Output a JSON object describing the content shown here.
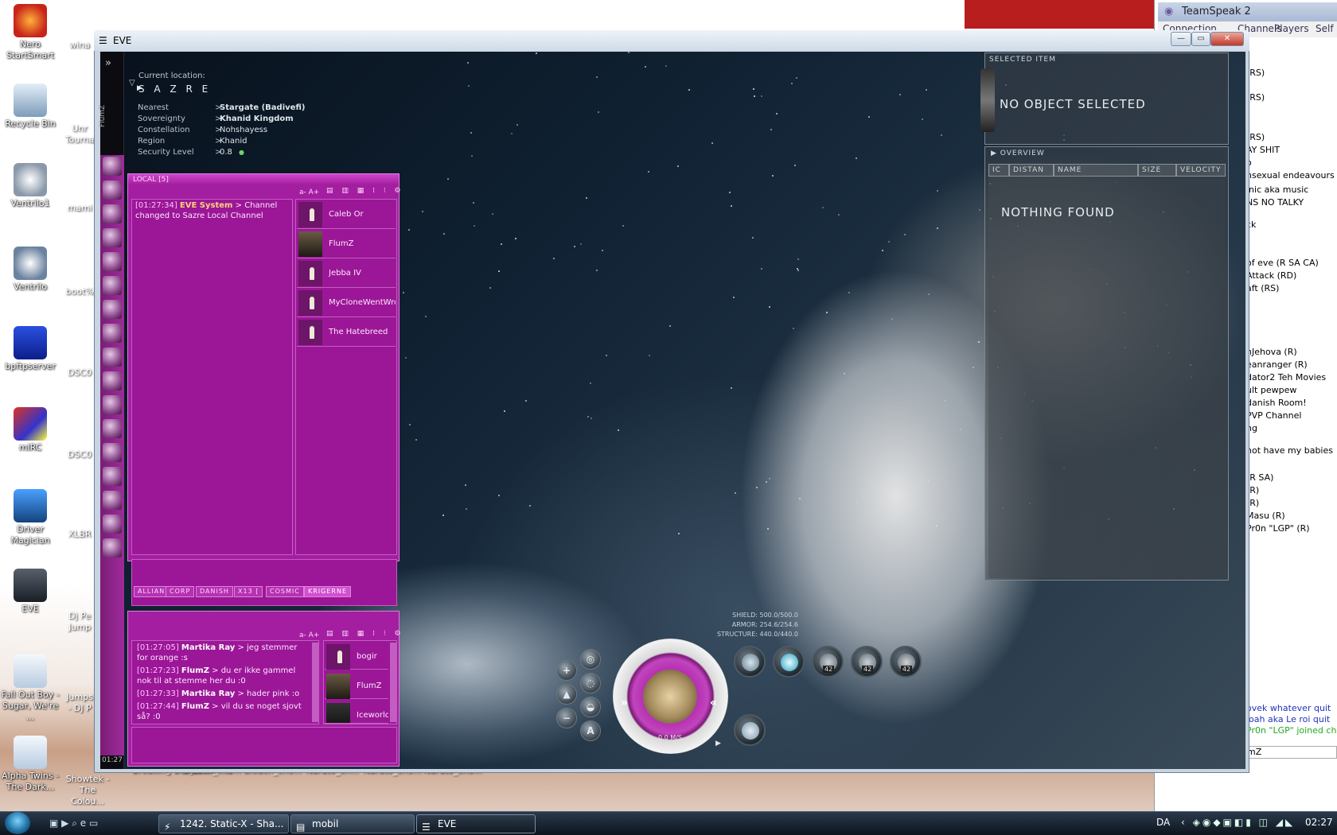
{
  "desktop": {
    "icons": [
      {
        "label": "Nero StartSmart",
        "color": "#d8401a"
      },
      {
        "label": "Recycle Bin",
        "color": "#9cb7d0"
      },
      {
        "label": "Ventrilo1",
        "color": "#c8d0da"
      },
      {
        "label": "Ventrilo",
        "color": "#c8d0da"
      },
      {
        "label": "bpftpserver",
        "color": "#1a3fcf"
      },
      {
        "label": "mIRC",
        "color": "#cc2222"
      },
      {
        "label": "Driver Magician",
        "color": "#2a66b8"
      },
      {
        "label": "EVE",
        "color": "#2a3240"
      },
      {
        "label": "Fall Out Boy - Sugar, We're ...",
        "color": "#4a90d0"
      },
      {
        "label": "Alpha Twins - The Dark...",
        "color": "#4a90d0"
      }
    ],
    "column2": [
      {
        "label": "wina"
      },
      {
        "label": "Unr Tourna"
      },
      {
        "label": "mami"
      },
      {
        "label": "boot%"
      },
      {
        "label": "DSC0"
      },
      {
        "label": "DSC0"
      },
      {
        "label": "XLBR"
      },
      {
        "label": "Dj Pe Jump"
      },
      {
        "label": "Jumps - DJ P"
      },
      {
        "label": "Showtek - The Colou..."
      }
    ],
    "bottom_row": [
      "Breaking Benjamin - ...",
      "Bleach_ch3...",
      "Bleach_ch3...",
      "Naruto_ch...",
      "Naruto_ch3...",
      "Naruto_ch3..."
    ]
  },
  "teamspeak": {
    "title": "TeamSpeak 2",
    "menu": [
      "Connection",
      "Channels",
      "Players",
      "Self"
    ],
    "lines": [
      "(RS)",
      "(RS)",
      "(RS)",
      "AY SHIT",
      "o",
      "nsexual endeavours",
      "inic aka music",
      "NS NO TALKY",
      "ck",
      "of eve  (R SA CA)",
      "Attack   (RD)",
      "aft    (RS)",
      "nJehova  (R)",
      "eanranger  (R)",
      "dator2 Teh Movies",
      "ult pewpew",
      "danish Room!",
      "PVP Channel",
      "ng",
      "not have my babies",
      "(R SA)",
      "(R)",
      "(R)",
      "Masu  (R)",
      "Pr0n \"LGP\"  (R)"
    ],
    "chat": [
      "ovek whatever quit",
      "loah aka Le roi quit",
      "Pr0n \"LGP\" joined chan"
    ],
    "input": "mZ"
  },
  "eve_window": {
    "title": "EVE",
    "location": {
      "label": "Current location:",
      "system": "S A Z R E",
      "rows": [
        {
          "key": "Nearest",
          "value": "Stargate (Badivefi)"
        },
        {
          "key": "Sovereignty",
          "value": "Khanid Kingdom"
        },
        {
          "key": "Constellation",
          "value": "Nohshayess"
        },
        {
          "key": "Region",
          "value": "Khanid"
        },
        {
          "key": "Security Level",
          "value": "0.8"
        }
      ],
      "separator": ">"
    },
    "neocom": {
      "pilot": "FlumZ",
      "clock": "01:27",
      "toggle": "»"
    },
    "local_chat": {
      "title": "LOCAL [5]",
      "toolbar": "a- A+",
      "messages": [
        {
          "time": "[01:27:34]",
          "sender": "EVE System",
          "text": " > Channel changed to Sazre Local Channel"
        }
      ],
      "members": [
        "Caleb Or",
        "FlumZ",
        "Jebba IV",
        "MyCloneWentWrong",
        "The Hatebreed"
      ]
    },
    "corp_chat": {
      "tabs": [
        "ALLIAN",
        "CORP",
        "DANISH",
        "X13 [",
        "COSMIC",
        "KRIGERNE"
      ],
      "active_tab": "KRIGERNE",
      "toolbar": "a- A+",
      "messages": [
        {
          "time": "[01:27:05]",
          "sender": "Martika Ray",
          "text": " > jeg stemmer for orange :s"
        },
        {
          "time": "[01:27:23]",
          "sender": "FlumZ",
          "text": " > du er ikke gammel nok til at stemme her du :0"
        },
        {
          "time": "[01:27:33]",
          "sender": "Martika Ray",
          "text": " > hader pink :o"
        },
        {
          "time": "[01:27:44]",
          "sender": "FlumZ",
          "text": " > vil du se noget sjovt så? :0"
        }
      ],
      "members": [
        "bogir",
        "FlumZ",
        "Iceworld"
      ]
    },
    "selected_item": {
      "header": "SELECTED ITEM",
      "text": "NO OBJECT SELECTED"
    },
    "overview": {
      "header": "OVERVIEW",
      "columns": [
        "IC",
        "DISTAN",
        "NAME",
        "SIZE",
        "VELOCITY"
      ],
      "empty": "NOTHING FOUND"
    },
    "hud": {
      "shield": "SHIELD: 500.0/500.0",
      "armor": "ARMOR: 254.6/254.6",
      "structure": "STRUCTURE: 440.0/440.0",
      "speed": "0.0 M/S",
      "autopilot": "A",
      "module_counts": [
        "42",
        "42",
        "42"
      ]
    }
  },
  "taskbar": {
    "tasks": [
      {
        "label": "1242. Static-X - Sha...",
        "icon": "winamp-icon"
      },
      {
        "label": "mobil",
        "icon": "folder-icon"
      },
      {
        "label": "EVE",
        "icon": "eve-icon",
        "active": true
      }
    ],
    "lang": "DA",
    "clock": "02:27"
  }
}
